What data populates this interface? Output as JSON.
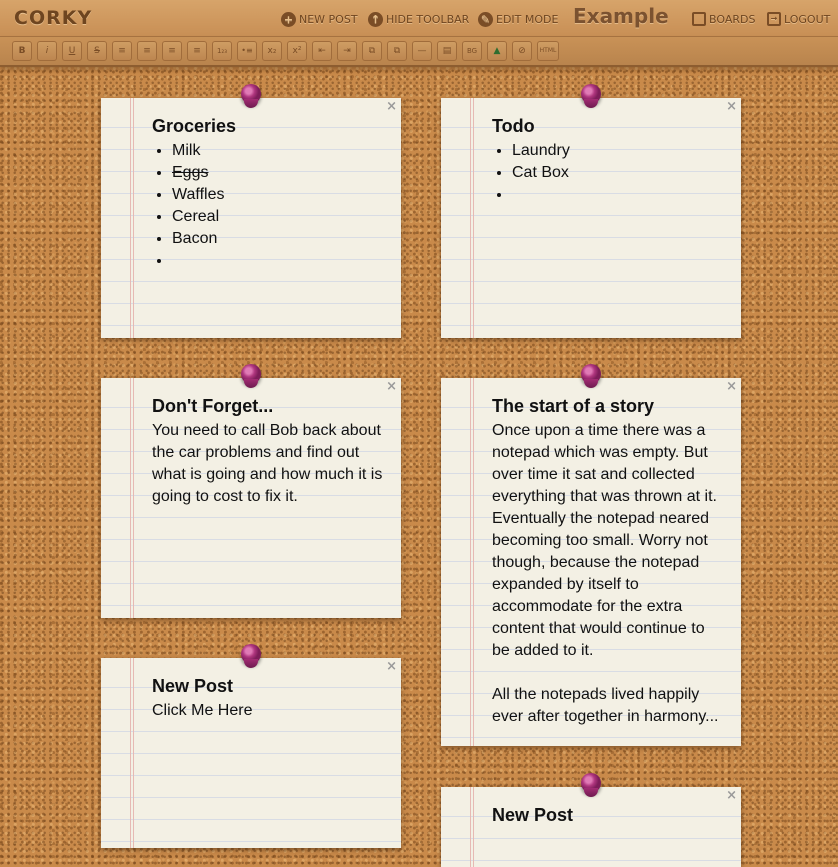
{
  "header": {
    "logo": "CORKY",
    "nav": [
      {
        "label": "NEW POST",
        "icon": "plus-circle-icon"
      },
      {
        "label": "HIDE TOOLBAR",
        "icon": "arrow-up-circle-icon"
      },
      {
        "label": "EDIT MODE",
        "icon": "pencil-circle-icon"
      }
    ],
    "board_title": "Example",
    "boards_label": "BOARDS",
    "logout_label": "LOGOUT"
  },
  "toolbar": {
    "buttons": [
      {
        "label": "B",
        "icon": "bold-icon"
      },
      {
        "label": "i",
        "icon": "italic-icon"
      },
      {
        "label": "U",
        "icon": "underline-icon"
      },
      {
        "label": "S",
        "icon": "strikethrough-icon"
      },
      {
        "label": "≡",
        "icon": "align-left-icon"
      },
      {
        "label": "≡",
        "icon": "align-center-icon"
      },
      {
        "label": "≡",
        "icon": "align-right-icon"
      },
      {
        "label": "≡",
        "icon": "justify-icon"
      },
      {
        "label": "1₂₃",
        "icon": "ordered-list-icon"
      },
      {
        "label": "•≡",
        "icon": "unordered-list-icon"
      },
      {
        "label": "x₂",
        "icon": "subscript-icon"
      },
      {
        "label": "x²",
        "icon": "superscript-icon"
      },
      {
        "label": "⇤",
        "icon": "outdent-icon"
      },
      {
        "label": "⇥",
        "icon": "indent-icon"
      },
      {
        "label": "⧉",
        "icon": "copy-icon"
      },
      {
        "label": "⧉",
        "icon": "paste-icon"
      },
      {
        "label": "—",
        "icon": "horizontal-rule-icon"
      },
      {
        "label": "▤",
        "icon": "text-color-icon"
      },
      {
        "label": "BG",
        "icon": "background-color-icon"
      },
      {
        "label": "▲",
        "icon": "image-icon"
      },
      {
        "label": "⊘",
        "icon": "clear-format-icon"
      },
      {
        "label": "HTML",
        "icon": "html-icon"
      }
    ]
  },
  "notes": {
    "groceries": {
      "title": "Groceries",
      "items": [
        "Milk",
        "Eggs",
        "Waffles",
        "Cereal",
        "Bacon",
        ""
      ]
    },
    "todo": {
      "title": "Todo",
      "items": [
        "Laundry",
        "Cat Box",
        ""
      ]
    },
    "dont_forget": {
      "title": "Don't Forget...",
      "text": "You  need to call Bob back about the car problems and find out what is going and how much it is going to cost to fix it."
    },
    "story": {
      "title": "The start of a story",
      "p1": "Once upon a time there was a notepad which was empty.  But over time it sat and collected everything that was thrown at it. Eventually the notepad neared becoming too small.  Worry not though, because the notepad expanded by itself to accommodate for the extra content that would continue to be added to it.",
      "p2": "All the notepads lived happily ever after together in harmony..."
    },
    "new_post_left": {
      "title": "New Post",
      "text": "Click Me Here"
    },
    "new_post_right": {
      "title": "New Post"
    }
  },
  "close_symbol": "×"
}
